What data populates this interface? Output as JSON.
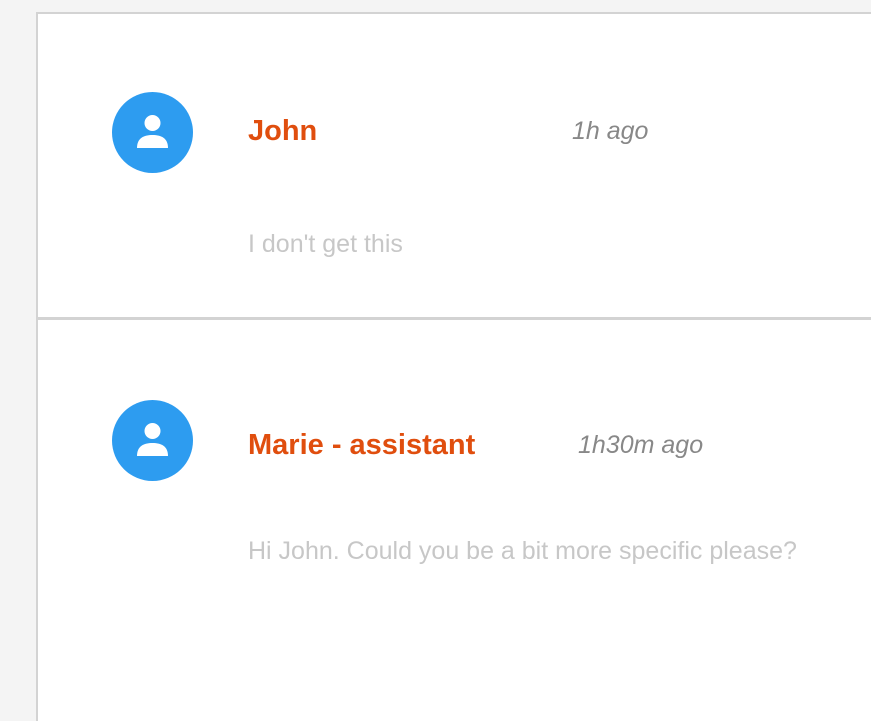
{
  "comments": [
    {
      "author": "John",
      "time": "1h ago",
      "text": "I don't get this",
      "avatar_icon": "user-icon"
    },
    {
      "author": "Marie - assistant",
      "time": "1h30m ago",
      "text": "Hi John. Could you be a bit more specific please?",
      "avatar_icon": "user-icon"
    }
  ],
  "colors": {
    "author": "#e04e0e",
    "avatar": "#2d9cf0",
    "time": "#888888",
    "text": "#c7c7c7",
    "border": "#d3d3d3"
  }
}
